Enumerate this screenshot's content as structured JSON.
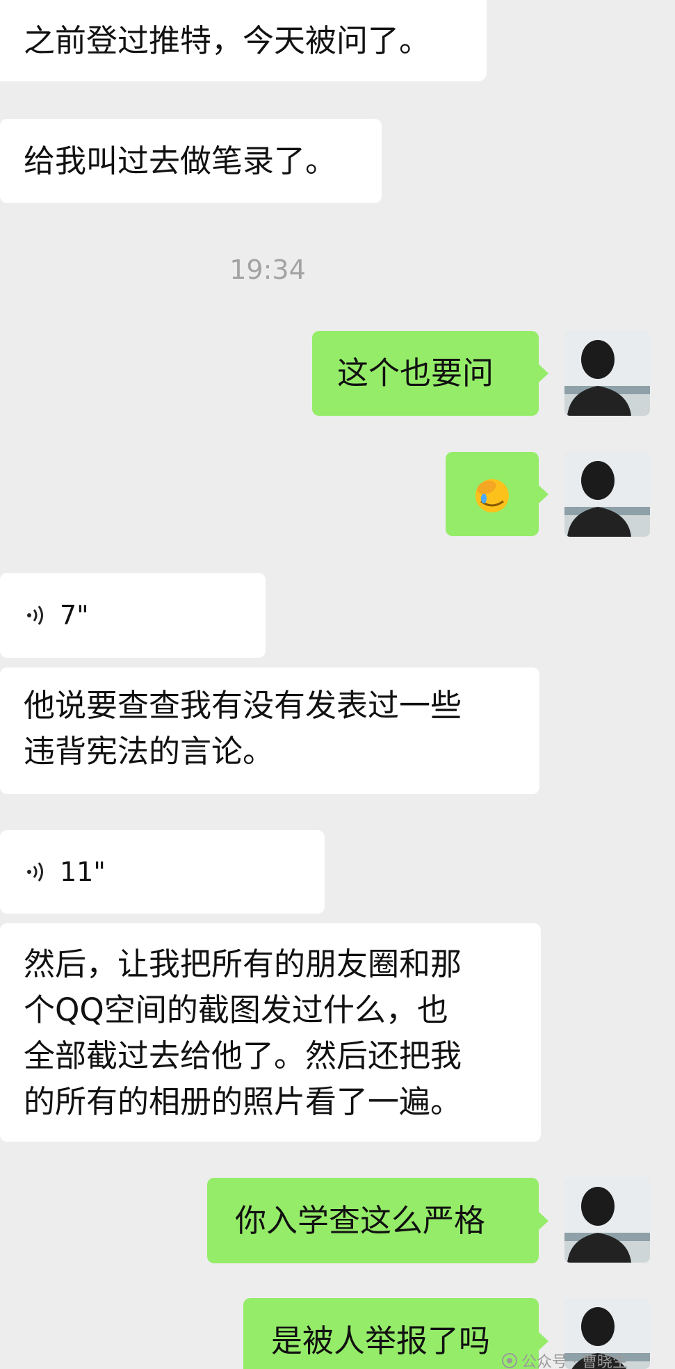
{
  "messages": {
    "m1": "之前登过推特，今天被问了。",
    "m2": "给我叫过去做笔录了。",
    "timestamp": "19:34",
    "m3": "这个也要问",
    "m4": "🤦",
    "voice1": "7\"",
    "m5": "他说要查查我有没有发表过一些\n违背宪法的言论。",
    "voice2": "11\"",
    "m6": "然后，让我把所有的朋友圈和那\n个QQ空间的截图发过什么，也\n全部截过去给他了。然后还把我\n的所有的相册的照片看了一遍。",
    "m7": "你入学查这么严格",
    "m8": "是被人举报了吗"
  },
  "watermark": "公众号 · 曹晓生",
  "colors": {
    "background": "#ededed",
    "incoming": "#ffffff",
    "outgoing": "#95ec69",
    "timestamp": "#a3a3a3"
  },
  "icons": {
    "voice": "voice-wave-icon",
    "avatar": "avatar-man-back-icon",
    "emoji": "facepalm-emoji"
  }
}
